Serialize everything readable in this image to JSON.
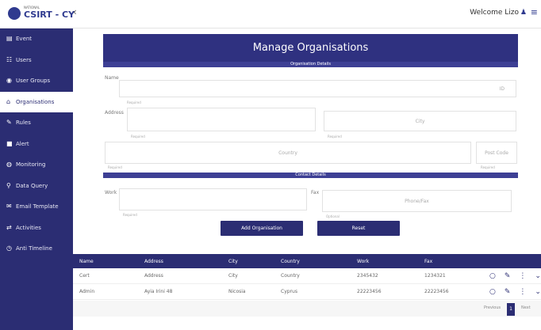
{
  "header": {
    "logo_top": "NATIONAL",
    "logo_name": "CSIRT - CY",
    "collapse_icon": "‹",
    "welcome": "Welcome Lizo",
    "user_icon": "user-icon",
    "menu_icon": "hamburger-icon"
  },
  "sidebar": {
    "items": [
      {
        "label": "Event",
        "icon": "▤"
      },
      {
        "label": "Users",
        "icon": "☷"
      },
      {
        "label": "User Groups",
        "icon": "◉"
      },
      {
        "label": "Organisations",
        "icon": "⌂"
      },
      {
        "label": "Rules",
        "icon": "✎"
      },
      {
        "label": "Alert",
        "icon": "■"
      },
      {
        "label": "Monitoring",
        "icon": "◍"
      },
      {
        "label": "Data Query",
        "icon": "⚲"
      },
      {
        "label": "Email Template",
        "icon": "✉"
      },
      {
        "label": "Activities",
        "icon": "⇄"
      },
      {
        "label": "Anti Timeline",
        "icon": "◷"
      }
    ]
  },
  "form": {
    "title": "Manage Organisations",
    "section_org": "Organisation Details",
    "name_label": "Name",
    "name_hint": "Required",
    "id_value": "ID",
    "address_label": "Address",
    "address_hint": "Required",
    "city_placeholder": "City",
    "city_hint": "Required",
    "country_placeholder": "Country",
    "country_hint": "Required",
    "postcode_placeholder": "Post Code",
    "postcode_hint": "Required",
    "section_contact": "Contact Details",
    "work_label": "Work",
    "work_hint": "Required",
    "fax_label": "Fax",
    "fax_placeholder": "Phone/Fax",
    "fax_hint": "Optional",
    "add_button": "Add Organisation",
    "reset_button": "Reset"
  },
  "table": {
    "columns": [
      "Name",
      "Address",
      "City",
      "Country",
      "Work",
      "Fax"
    ],
    "rows": [
      [
        "Cert",
        "Address",
        "City",
        "Country",
        "2345432",
        "1234321"
      ],
      [
        "Admin",
        "Ayia Irini 48",
        "Nicosia",
        "Cyprus",
        "22223456",
        "22223456"
      ]
    ],
    "action_icons": [
      "view-icon",
      "edit-icon",
      "more-icon",
      "expand-icon"
    ]
  },
  "pager": {
    "previous": "Previous",
    "current": "1",
    "next": "Next"
  }
}
